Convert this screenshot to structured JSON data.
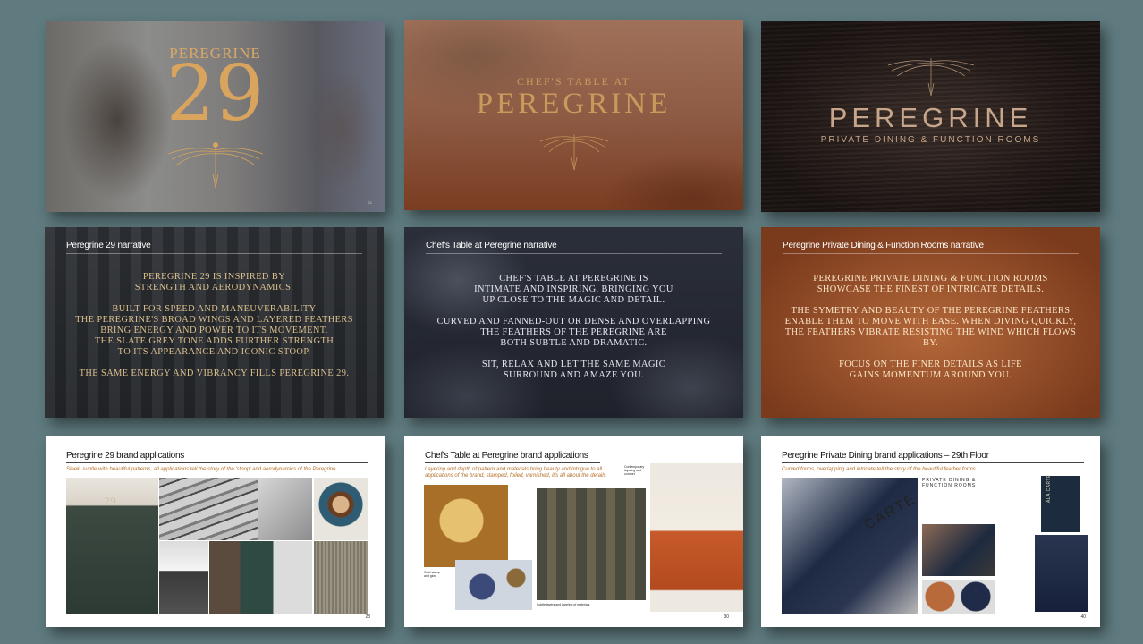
{
  "slides": {
    "peregrine29_cover": {
      "name": "PEREGRINE",
      "number": "29",
      "page": "21"
    },
    "chefs_table_cover": {
      "title": "CHEF'S TABLE AT",
      "name": "PEREGRINE"
    },
    "private_dining_cover": {
      "name": "PEREGRINE",
      "subtitle": "PRIVATE DINING & FUNCTION ROOMS"
    },
    "peregrine29_narrative": {
      "title": "Peregrine 29 narrative",
      "paragraphs": [
        [
          "Peregrine 29 is inspired by",
          "strength and aerodynamics."
        ],
        [
          "Built for speed and maneuverability",
          "the peregrine's broad wings and layered feathers",
          "bring energy and power to its movement.",
          "The slate grey tone adds further strength",
          "to its appearance and iconic stoop."
        ],
        [
          "The same energy and vibrancy fills Peregrine 29."
        ]
      ]
    },
    "chefs_table_narrative": {
      "title": "Chef's Table at Peregrine narrative",
      "paragraphs": [
        [
          "Chef's Table at Peregrine is",
          "intimate and inspiring, bringing you",
          "up close to the magic and detail."
        ],
        [
          "Curved and fanned-out or dense and overlapping",
          "the feathers of the peregrine are",
          "both subtle and dramatic."
        ],
        [
          "Sit, relax and let the same magic",
          "surround and amaze you."
        ]
      ]
    },
    "private_dining_narrative": {
      "title": "Peregrine Private Dining & Function Rooms narrative",
      "paragraphs": [
        [
          "Peregrine private dining & function rooms",
          "showcase the finest of intricate details."
        ],
        [
          "The symetry and beauty of the peregrine feathers",
          "enable them to move with ease. When diving quickly,",
          "the feathers vibrate resisting the wind which flows by."
        ],
        [
          "Focus on the finer details as life",
          "gains momentum around you."
        ]
      ]
    },
    "peregrine29_applications": {
      "title": "Peregrine 29 brand applications",
      "subtitle": "Sleek, subtle with beautiful patterns, all applications tell the story of the 'stoop' and aerodynamics of the Peregrine.",
      "apron_number": "29",
      "page": "28"
    },
    "chefs_table_applications": {
      "title": "Chef's Table at Peregrine brand applications",
      "subtitle_lines": [
        "Layering and depth of pattern and materials bring beauty and intrigue to all",
        "applications of the brand, stamped, foiled, varnished, it's all about the details"
      ],
      "caption_1": "Gold stamp and glow",
      "caption_2": "Subtle layers and layering of materials",
      "caption_3": "Contemporary layering and comfort",
      "page": "30"
    },
    "private_dining_applications": {
      "title": "Peregrine Private Dining brand applications – 29th Floor",
      "subtitle": "Curved forms, overlapping and intricate tell the story of the beautiful feather forms",
      "menu_word": "CARTE",
      "card_title": "ALA CARTE",
      "round_title": "PRIVATE DINING & FUNCTION ROOMS",
      "page": "40"
    }
  },
  "colors": {
    "background": "#5f7b7f",
    "gold": "#c99a5c",
    "copper": "#b4683a",
    "accent_text": "#b5702a"
  }
}
